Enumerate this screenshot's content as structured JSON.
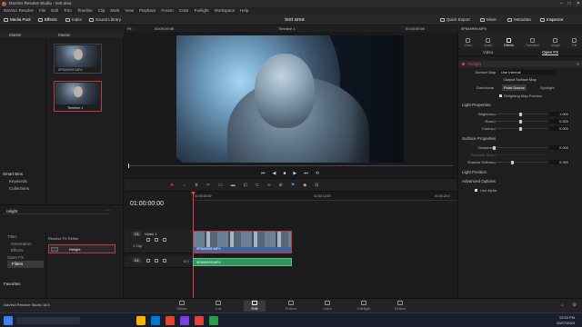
{
  "window": {
    "app_title": "DaVinci Resolve Studio - test area",
    "controls": [
      "–",
      "□",
      "✕"
    ]
  },
  "menu": [
    "DaVinci Resolve",
    "File",
    "Edit",
    "Trim",
    "Timeline",
    "Clip",
    "Mark",
    "View",
    "Playback",
    "Fusion",
    "Color",
    "Fairlight",
    "Workspace",
    "Help"
  ],
  "toolbar": {
    "media_pool": "Media Pool",
    "effects": "Effects",
    "index": "Index",
    "sound_library": "Sound Library",
    "project_title": "test area",
    "quick_export": "Quick Export",
    "mixer": "Mixer",
    "metadata": "Metadata",
    "inspector": "Inspector"
  },
  "subbar": {
    "fit": "Fit",
    "timecode_left": "00:00:09:49",
    "timeline_name": "Timeline 1",
    "timecode_right": "01:00:00:00"
  },
  "left_panel": {
    "tabs": [
      "Master",
      "Master"
    ],
    "clip1_name": "0P5A9999.MP4",
    "clip2_name": "Timeline 1",
    "smart_bins": "Smart Bins",
    "bins": [
      "Keywords",
      "Collections"
    ]
  },
  "effects_panel": {
    "search": "relight",
    "tree": [
      "Titles",
      "Generators",
      "Effects",
      "Open FX",
      "Filters"
    ],
    "selected": "Filters",
    "favorites": "Favorites",
    "group_label": "Resolve FX Refine",
    "result": "Relight"
  },
  "timeline": {
    "timecode": "01:00:00:00",
    "ruler": [
      "01:00:00:00",
      "01:00:12:00",
      "01:00:24:0"
    ],
    "video_track": "V1",
    "video_track_name": "Video 1",
    "clip_count": "1 Clip",
    "audio_track": "A1",
    "audio_level": "2.0",
    "video_clip_name": "0P5A9999.MP4",
    "audio_clip_name": "0P5A9999.MP4"
  },
  "inspector": {
    "file": "0P5A9999.MP4",
    "tabs": [
      "Video",
      "Audio",
      "Effects",
      "Transition",
      "Image",
      "File"
    ],
    "sub_tabs": [
      "Video",
      "Open FX"
    ],
    "effect_name": "Relight",
    "surface_map_label": "Surface Map",
    "surface_map_value": "Use Internal",
    "output_surface_map": "Output Surface Map",
    "light_modes": [
      "Directional",
      "Point Source",
      "Spotlight"
    ],
    "relighting_preview": "Relighting Map Preview",
    "light_properties": "Light Properties",
    "brightness": {
      "label": "Brightness",
      "value": "1.000"
    },
    "reach": {
      "label": "Reach",
      "value": "0.500"
    },
    "contrast": {
      "label": "Contrast",
      "value": "0.000"
    },
    "surface_properties": "Surface Properties",
    "glossiness": {
      "label": "Glossiness",
      "value": "0.000"
    },
    "specular": {
      "label": "Specular Boost",
      "value": ""
    },
    "shadow_softness": {
      "label": "Shadow Softness",
      "value": "0.350"
    },
    "light_position": "Light Position",
    "advanced_options": "Advanced Options",
    "use_alpha": "Use Alpha"
  },
  "pages": [
    "Media",
    "Cut",
    "Edit",
    "Fusion",
    "Color",
    "Fairlight",
    "Deliver"
  ],
  "active_page": "Edit",
  "footer": {
    "app": "DaVinci Resolve Studio 18.5",
    "clock": "12:53 PM",
    "date": "20/07/2023"
  },
  "colors": {
    "accent": "#e8413a",
    "clip_video": "#5a7bb8",
    "clip_audio": "#3aa86c",
    "playhead": "#e8413a"
  }
}
